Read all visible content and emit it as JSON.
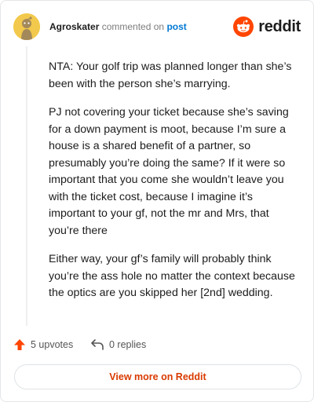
{
  "header": {
    "username": "Agroskater",
    "action_text": "commented on",
    "post_link": "post",
    "brand_name": "reddit",
    "avatar_color": "#f2c94c",
    "brand_color": "#ff4500"
  },
  "comment": {
    "paragraphs": [
      "NTA: Your golf trip was planned longer than she’s been with the person she’s marrying.",
      "PJ not covering your ticket because she’s saving for a down payment is moot, because I’m sure a house is a shared benefit of a partner, so presumably you’re doing the same? If it were so important that you come she wouldn’t leave you with the ticket cost, because I imagine it’s important to your gf, not the mr and Mrs, that you’re there",
      "Either way, your gf’s family will probably think you’re the ass hole no matter the context because the optics are you skipped her [2nd] wedding."
    ]
  },
  "actions": {
    "upvotes_label": "5 upvotes",
    "replies_label": "0 replies",
    "upvote_icon": "upvote-arrow-icon",
    "reply_icon": "reply-arrow-icon",
    "upvote_color": "#ff4500"
  },
  "footer": {
    "view_more_label": "View more on Reddit"
  }
}
